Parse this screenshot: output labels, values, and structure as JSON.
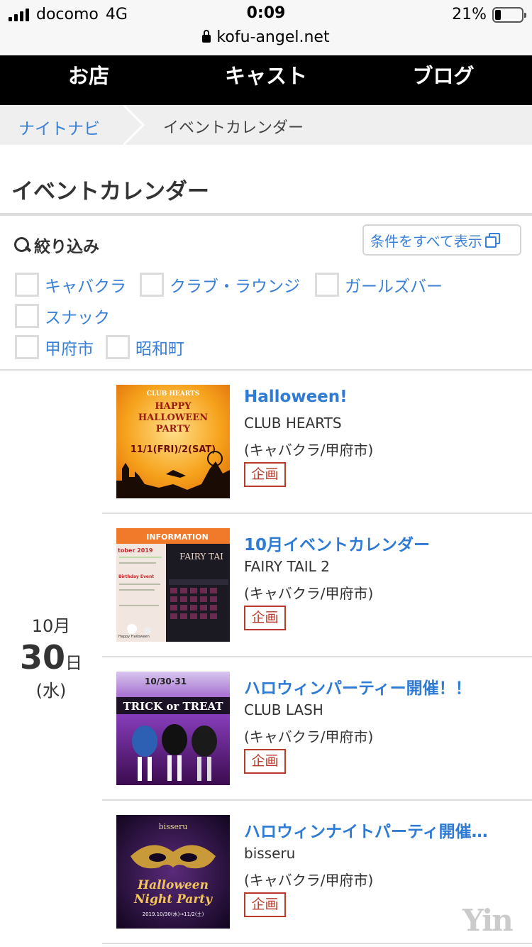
{
  "status_bar": {
    "carrier": "docomo",
    "network": "4G",
    "time": "0:09",
    "battery_text": "21%",
    "battery_level": 0.21
  },
  "browser": {
    "url": "kofu-angel.net"
  },
  "nav": {
    "items": [
      "お店",
      "キャスト",
      "ブログ"
    ]
  },
  "breadcrumb": {
    "home": "ナイトナビ",
    "current": "イベントカレンダー"
  },
  "page": {
    "title": "イベントカレンダー"
  },
  "filter": {
    "label": "絞り込み",
    "show_all": "条件をすべて表示",
    "categories": [
      "キャバクラ",
      "クラブ・ラウンジ",
      "ガールズバー",
      "スナック"
    ],
    "areas": [
      "甲府市",
      "昭和町"
    ]
  },
  "date": {
    "month": "10月",
    "day": "30",
    "day_suffix": "日",
    "weekday": "(水)"
  },
  "events": [
    {
      "title": "Halloween!",
      "shop": "CLUB HEARTS",
      "category": "(キャバクラ/甲府市)",
      "tag": "企画"
    },
    {
      "title": "10月イベントカレンダー",
      "shop": "FAIRY TAIL 2",
      "category": "(キャバクラ/甲府市)",
      "tag": "企画"
    },
    {
      "title": "ハロウィンパーティー開催！！",
      "shop": "CLUB LASH",
      "category": "(キャバクラ/甲府市)",
      "tag": "企画"
    },
    {
      "title": "ハロウィンナイトパーティ開催…",
      "shop": "bisseru",
      "category": "(キャバクラ/甲府市)",
      "tag": "企画"
    }
  ],
  "thumbs": {
    "hearts": {
      "line1": "CLUB HEARTS",
      "line2": "HAPPY",
      "line3": "HALLOWEEN",
      "line4": "PARTY",
      "dates": "11/1(FRI)/2(SAT)"
    },
    "fairy": {
      "banner": "INFORMATION",
      "month": "tober 2019",
      "logo": "FAIRY TAI",
      "event": "Birthday Event",
      "footer": "Happy Halloween"
    },
    "lash": {
      "dates": "10/30·31",
      "banner": "TRICK or TREAT"
    },
    "bisseru": {
      "brand": "bisseru",
      "script1": "Halloween",
      "script2": "Night Party",
      "dates": "2019.10/30(水)→11/2(土)"
    }
  },
  "watermark": "Yin"
}
